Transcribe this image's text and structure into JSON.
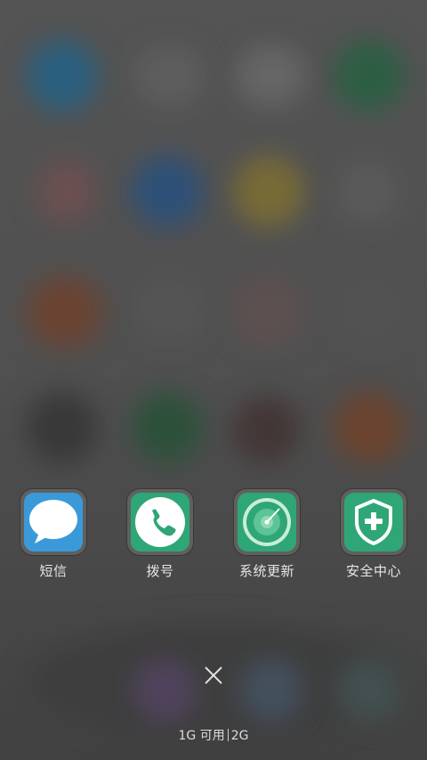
{
  "apps": [
    {
      "label": "短信",
      "icon": "message-icon",
      "color": "#3a9ad9"
    },
    {
      "label": "拨号",
      "icon": "phone-icon",
      "color": "#2fa676"
    },
    {
      "label": "系统更新",
      "icon": "update-icon",
      "color": "#2fa676"
    },
    {
      "label": "安全中心",
      "icon": "shield-plus-icon",
      "color": "#2fa676"
    }
  ],
  "close": {
    "icon": "close-icon"
  },
  "memory": {
    "available": "1G 可用",
    "total": "2G"
  }
}
